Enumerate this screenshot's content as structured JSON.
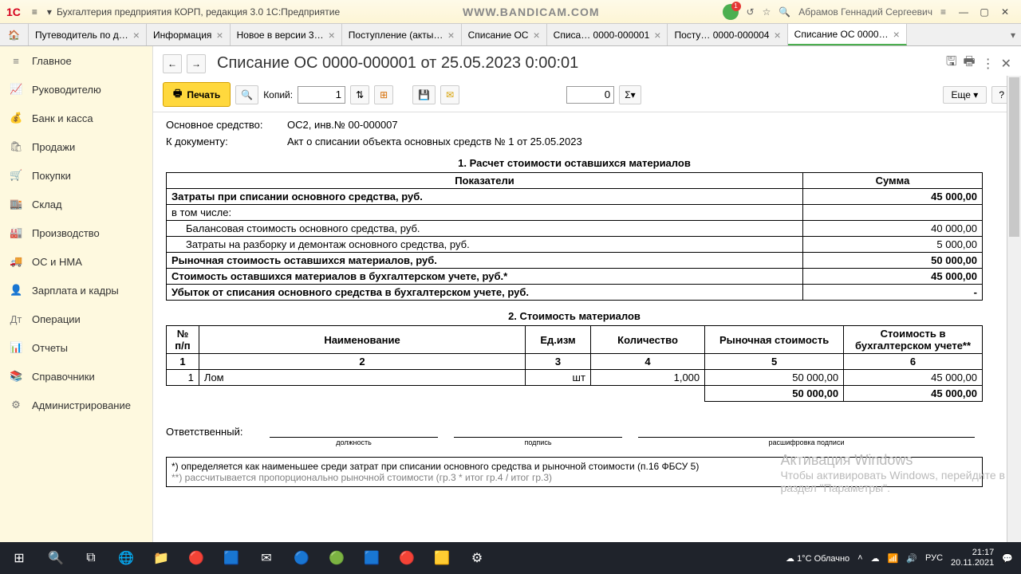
{
  "app": {
    "title": "Бухгалтерия предприятия КОРП, редакция 3.0 1С:Предприятие",
    "watermark": "WWW.BANDICAM.COM",
    "user": "Абрамов Геннадий Сергеевич"
  },
  "tabs": [
    {
      "label": "Путеводитель по д…"
    },
    {
      "label": "Информация"
    },
    {
      "label": "Новое в версии 3…"
    },
    {
      "label": "Поступление (акты…"
    },
    {
      "label": "Списание ОС"
    },
    {
      "label": "Списа… 0000-000001"
    },
    {
      "label": "Посту… 0000-000004"
    },
    {
      "label": "Списание ОС 0000…",
      "active": true
    }
  ],
  "sidebar": [
    {
      "icon": "≡",
      "label": "Главное"
    },
    {
      "icon": "📈",
      "label": "Руководителю"
    },
    {
      "icon": "💰",
      "label": "Банк и касса"
    },
    {
      "icon": "🛍",
      "label": "Продажи"
    },
    {
      "icon": "🛒",
      "label": "Покупки"
    },
    {
      "icon": "🏬",
      "label": "Склад"
    },
    {
      "icon": "🏭",
      "label": "Производство"
    },
    {
      "icon": "🚚",
      "label": "ОС и НМА"
    },
    {
      "icon": "👤",
      "label": "Зарплата и кадры"
    },
    {
      "icon": "Дт",
      "label": "Операции"
    },
    {
      "icon": "📊",
      "label": "Отчеты"
    },
    {
      "icon": "📚",
      "label": "Справочники"
    },
    {
      "icon": "⚙",
      "label": "Администрирование"
    }
  ],
  "doc": {
    "title": "Списание ОС 0000-000001 от 25.05.2023 0:00:01",
    "print": "Печать",
    "copies_label": "Копий:",
    "copies": "1",
    "num": "0",
    "more": "Еще",
    "sigma": "Σ",
    "info": {
      "asset_label": "Основное средство:",
      "asset_value": "ОС2, инв.№ 00-000007",
      "ref_label": "К документу:",
      "ref_value": "Акт о списании объекта основных средств № 1 от 25.05.2023"
    },
    "sec1_title": "1. Расчет стоимости оставшихся материалов",
    "table1": {
      "col1": "Показатели",
      "col2": "Сумма",
      "rows": [
        {
          "label": "Затраты при списании основного средства, руб.",
          "amount": "45 000,00",
          "bold": true
        },
        {
          "label": "в том числе:",
          "amount": "",
          "bold": false
        },
        {
          "label": "Балансовая стоимость основного средства, руб.",
          "amount": "40 000,00",
          "indent": true
        },
        {
          "label": "Затраты на разборку и демонтаж основного средства, руб.",
          "amount": "5 000,00",
          "indent": true
        },
        {
          "label": "Рыночная стоимость оставшихся материалов, руб.",
          "amount": "50 000,00",
          "bold": true
        },
        {
          "label": "Стоимость оставшихся материалов в бухгалтерском учете, руб.*",
          "amount": "45 000,00",
          "bold": true
        },
        {
          "label": "Убыток от списания основного средства в бухгалтерском учете, руб.",
          "amount": "-",
          "bold": true
        }
      ]
    },
    "sec2_title": "2. Стоимость материалов",
    "table2": {
      "headers": [
        "№ п/п",
        "Наименование",
        "Ед.изм",
        "Количество",
        "Рыночная стоимость",
        "Стоимость в бухгалтерском учете**"
      ],
      "idx": [
        "1",
        "2",
        "3",
        "4",
        "5",
        "6"
      ],
      "rows": [
        {
          "n": "1",
          "name": "Лом",
          "unit": "шт",
          "qty": "1,000",
          "market": "50 000,00",
          "book": "45 000,00"
        }
      ],
      "totals": {
        "market": "50 000,00",
        "book": "45 000,00"
      }
    },
    "sign": {
      "label": "Ответственный:",
      "c1": "должность",
      "c2": "подпись",
      "c3": "расшифровка подписи"
    },
    "footnote1": "*) определяется как наименьшее среди затрат при списании основного средства и рыночной стоимости (п.16 ФБСУ 5)",
    "footnote2": "**) рассчитывается пропорционально рыночной стоимости (гр.3 * итог гр.4 / итог гр.3)"
  },
  "windows_activate": {
    "line1": "Активация Windows",
    "line2": "Чтобы активировать Windows, перейдите в",
    "line3": "раздел \"Параметры\"."
  },
  "weather": "1°C Облачно",
  "clock": {
    "time": "21:17",
    "date": "20.11.2021"
  },
  "lang": "РУС"
}
